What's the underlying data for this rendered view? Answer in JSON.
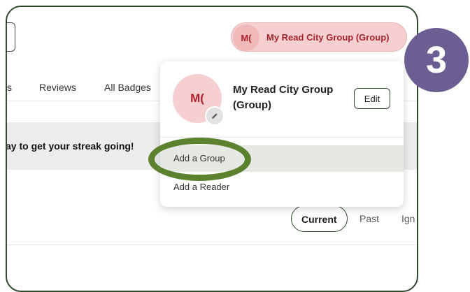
{
  "group_switcher": {
    "initials": "M(",
    "label": "My Read City Group (Group)"
  },
  "tabs": [
    {
      "label": "s"
    },
    {
      "label": "Reviews"
    },
    {
      "label": "All Badges"
    }
  ],
  "streak_message": "ay to get your streak going!",
  "filter_tabs": [
    {
      "label": "Current"
    },
    {
      "label": "Past"
    },
    {
      "label": "Ign"
    }
  ],
  "dropdown": {
    "initials": "M(",
    "name": "My Read City Group (Group)",
    "edit_label": "Edit",
    "pencil_icon": "pencil-icon",
    "items": [
      {
        "label": "Add a Group"
      },
      {
        "label": "Add a Reader"
      }
    ]
  },
  "step_number": "3",
  "colors": {
    "accent_green": "#5c8230",
    "frame_border": "#2f4a2c",
    "brand_red": "#a5232b",
    "pill_bg": "#f6d0d0",
    "badge_purple": "#6b5e93"
  }
}
